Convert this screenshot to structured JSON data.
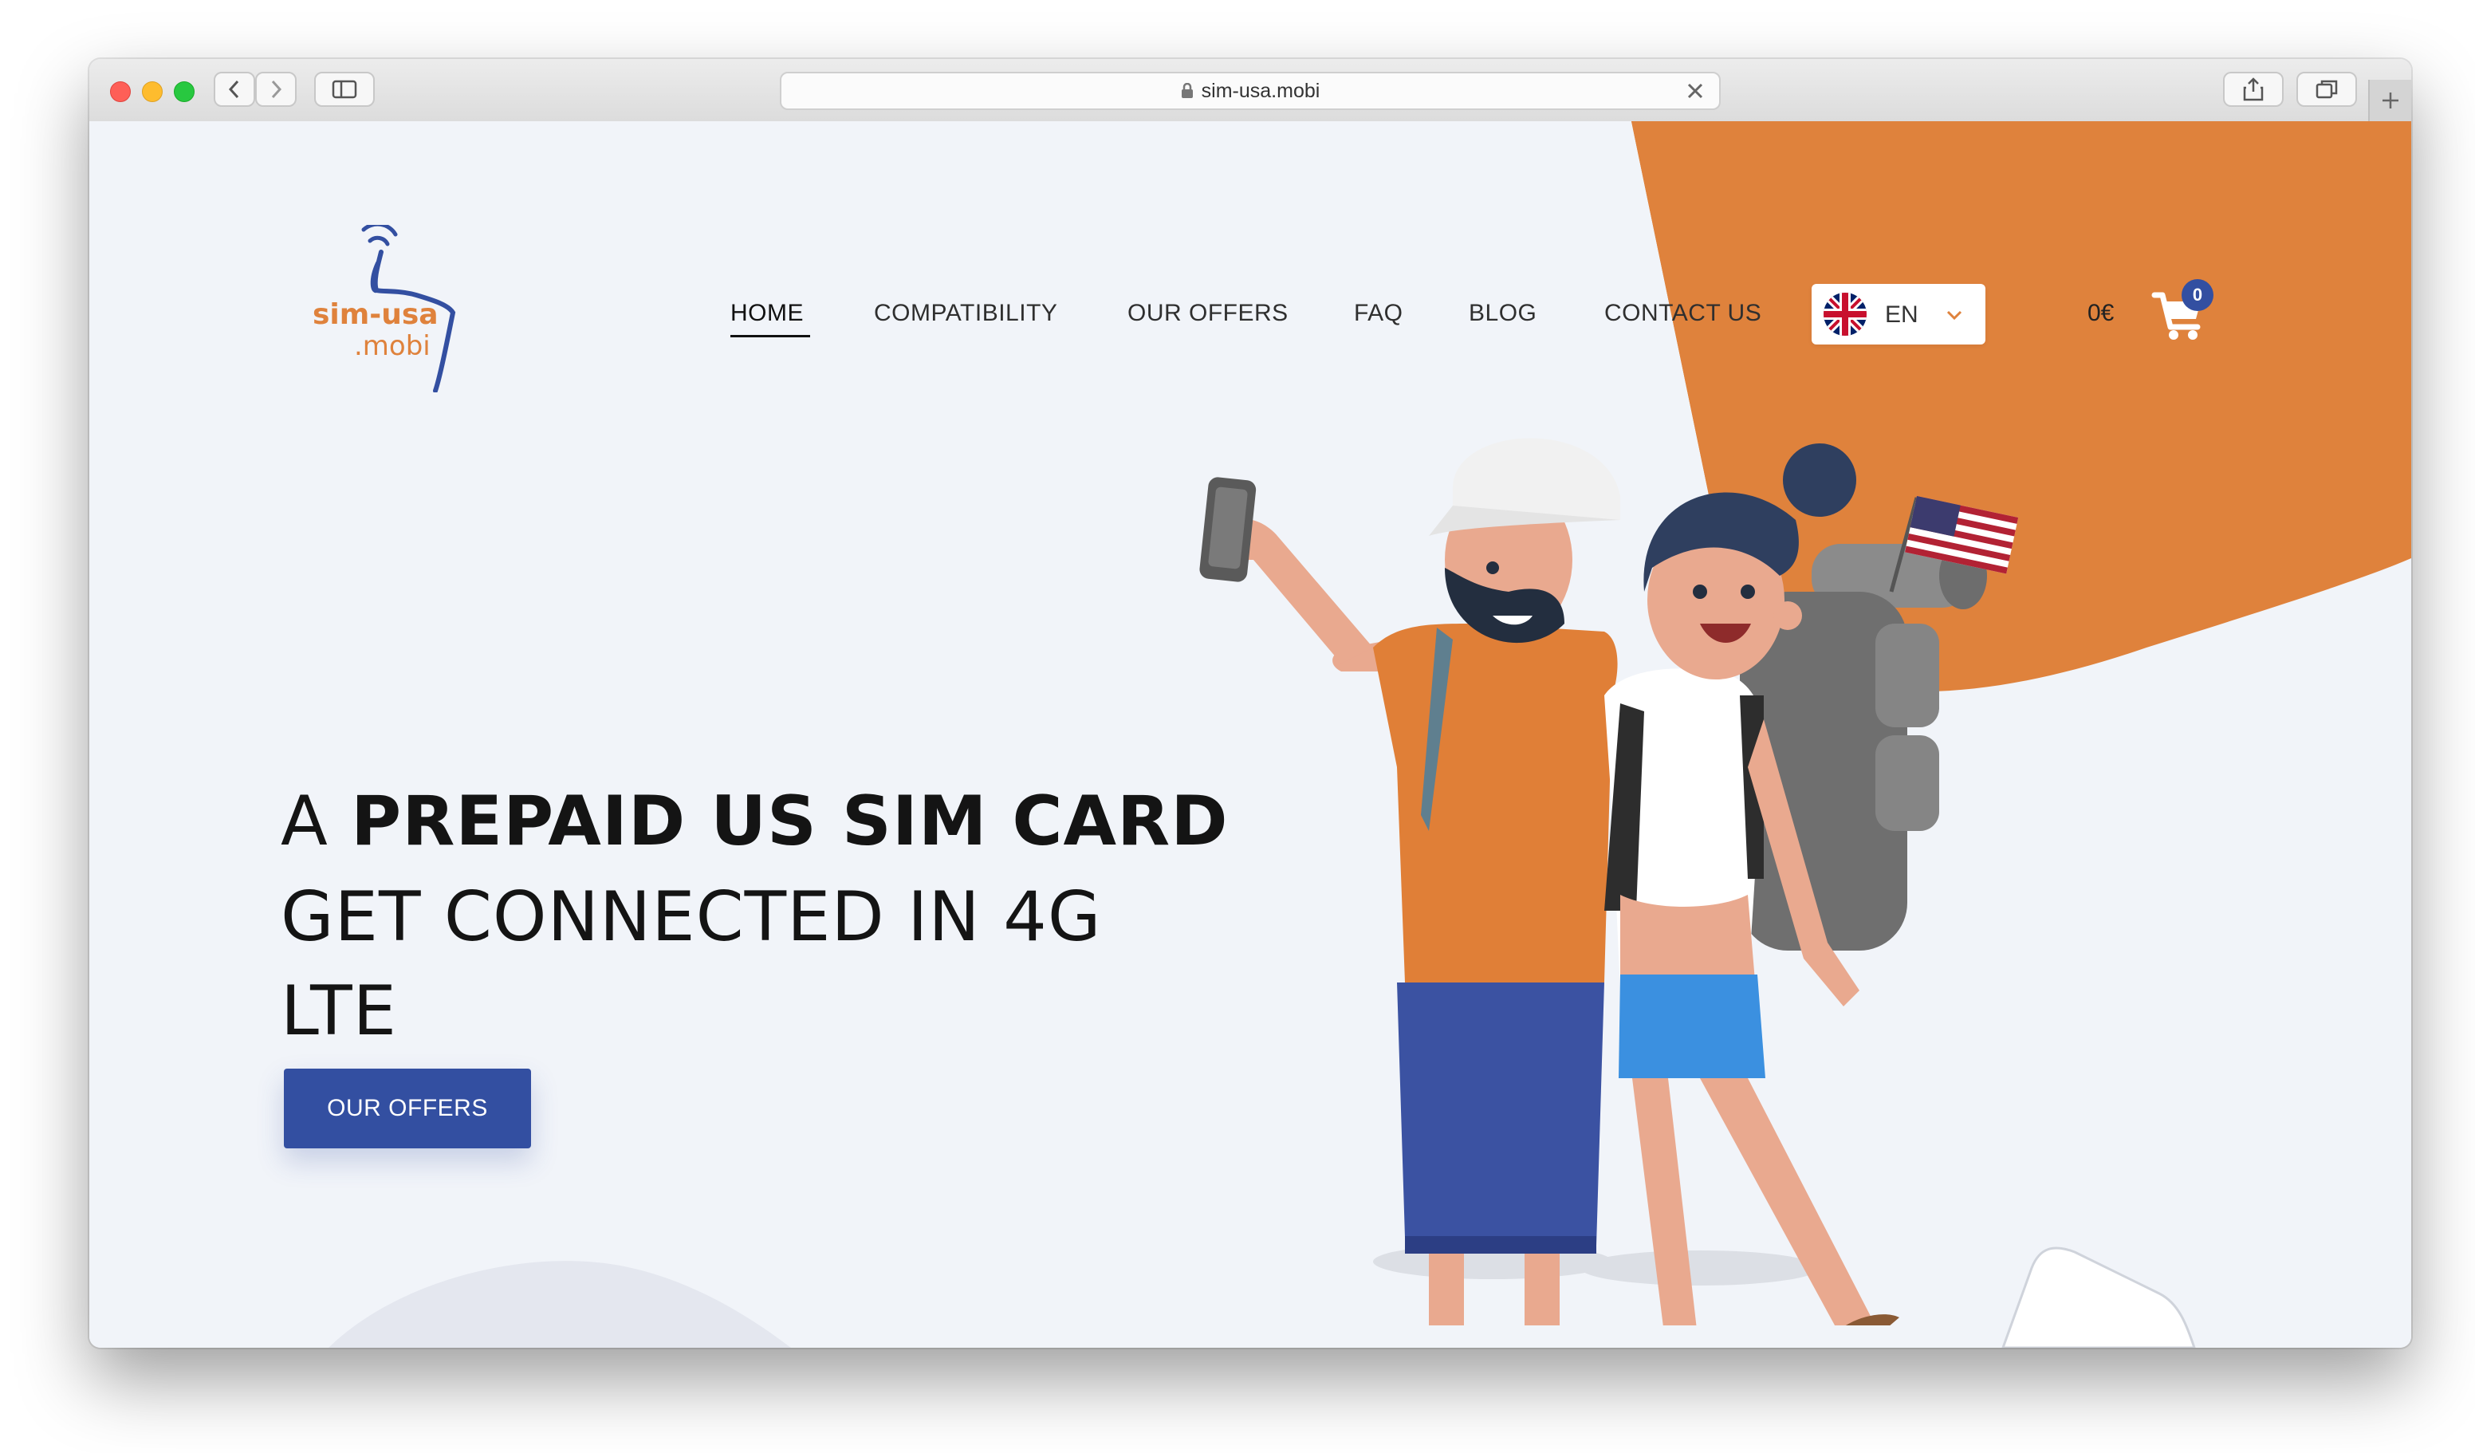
{
  "browser": {
    "url": "sim-usa.mobi"
  },
  "site": {
    "logo_line1": "sim-usa",
    "logo_line2": ".mobi",
    "nav": [
      {
        "label": "HOME",
        "active": true
      },
      {
        "label": "COMPATIBILITY"
      },
      {
        "label": "OUR OFFERS"
      },
      {
        "label": "FAQ"
      },
      {
        "label": "BLOG"
      },
      {
        "label": "CONTACT US"
      }
    ],
    "language": {
      "code": "EN",
      "icon": "uk-flag-icon"
    },
    "cart": {
      "total": "0€",
      "count": "0",
      "icon": "shopping-cart-icon"
    }
  },
  "hero": {
    "line1_prefix": "A ",
    "line1_bold": "PREPAID US SIM CARD",
    "line2": "GET CONNECTED IN 4G",
    "line3": "LTE",
    "cta_label": "OUR OFFERS"
  },
  "colors": {
    "accent_orange": "#df823c",
    "brand_blue": "#334fa1",
    "page_bg": "#f1f4f9"
  }
}
